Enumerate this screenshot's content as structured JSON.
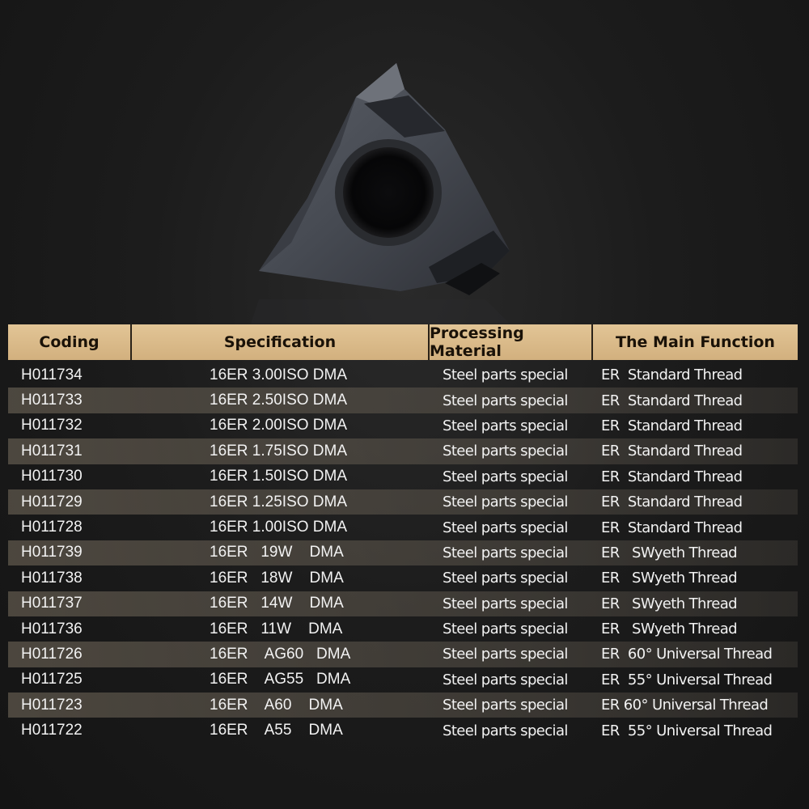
{
  "table": {
    "headers": [
      "Coding",
      "Specification",
      "Processing Material",
      "The Main Function"
    ],
    "rows": [
      [
        "H011734",
        "16ER 3.00ISO DMA",
        "Steel parts special",
        "ER  Standard Thread"
      ],
      [
        "H011733",
        "16ER 2.50ISO DMA",
        "Steel parts special",
        "ER  Standard Thread"
      ],
      [
        "H011732",
        "16ER 2.00ISO DMA",
        "Steel parts special",
        "ER  Standard Thread"
      ],
      [
        "H011731",
        "16ER 1.75ISO DMA",
        "Steel parts special",
        "ER  Standard Thread"
      ],
      [
        "H011730",
        "16ER 1.50ISO DMA",
        "Steel parts special",
        "ER  Standard Thread"
      ],
      [
        "H011729",
        "16ER 1.25ISO DMA",
        "Steel parts special",
        "ER  Standard Thread"
      ],
      [
        "H011728",
        "16ER 1.00ISO DMA",
        "Steel parts special",
        "ER  Standard Thread"
      ],
      [
        "H011739",
        "16ER   19W    DMA",
        "Steel parts special",
        "ER   SWyeth Thread"
      ],
      [
        "H011738",
        "16ER   18W    DMA",
        "Steel parts special",
        "ER   SWyeth Thread"
      ],
      [
        "H011737",
        "16ER   14W    DMA",
        "Steel parts special",
        "ER   SWyeth Thread"
      ],
      [
        "H011736",
        "16ER   11W    DMA",
        "Steel parts special",
        "ER   SWyeth Thread"
      ],
      [
        "H011726",
        "16ER    AG60   DMA",
        "Steel parts special",
        "ER  60° Universal Thread"
      ],
      [
        "H011725",
        "16ER    AG55   DMA",
        "Steel parts special",
        "ER  55° Universal Thread"
      ],
      [
        "H011723",
        "16ER    A60    DMA",
        "Steel parts special",
        "ER 60° Universal Thread"
      ],
      [
        "H011722",
        "16ER    A55    DMA",
        "Steel parts special",
        "ER  55° Universal Thread"
      ]
    ]
  }
}
